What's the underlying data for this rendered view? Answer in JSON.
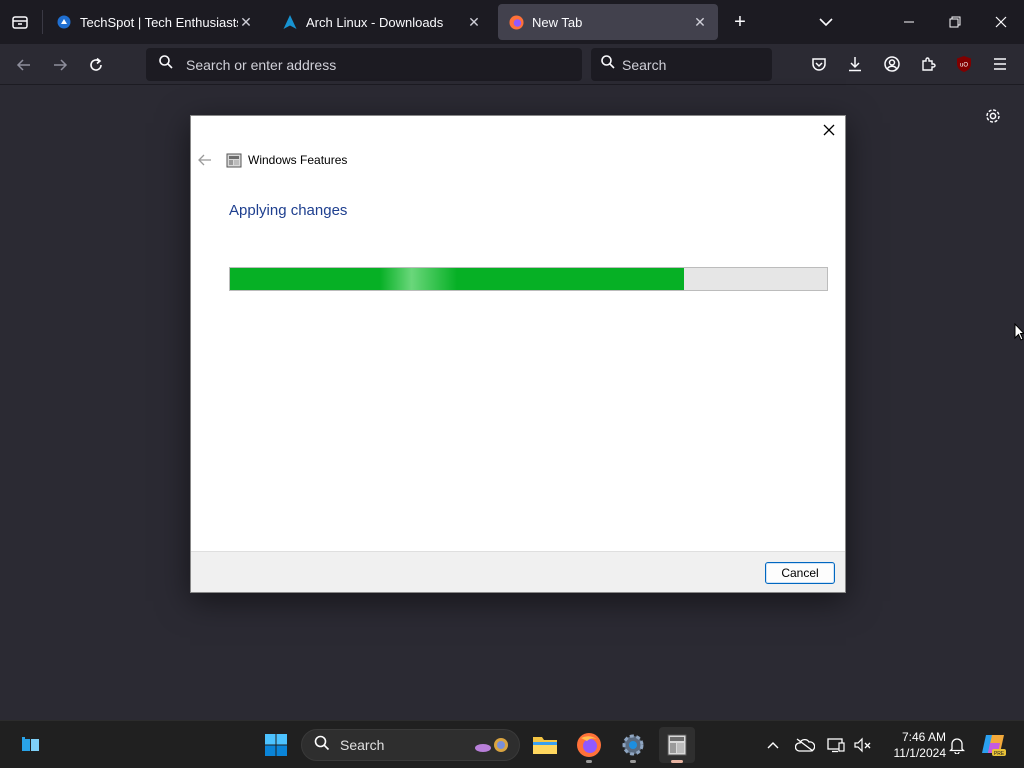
{
  "browser": {
    "tabs": [
      {
        "title": "TechSpot | Tech Enthusiasts, Po",
        "active": false,
        "favicon": "techspot-icon"
      },
      {
        "title": "Arch Linux - Downloads",
        "active": false,
        "favicon": "arch-linux-icon"
      },
      {
        "title": "New Tab",
        "active": true,
        "favicon": "firefox-icon"
      }
    ],
    "address_placeholder": "Search or enter address",
    "search_placeholder": "Search"
  },
  "dialog": {
    "app_title": "Windows Features",
    "heading": "Applying changes",
    "progress_fraction": 0.76,
    "cancel_label": "Cancel"
  },
  "taskbar": {
    "search_label": "Search",
    "time": "7:46 AM",
    "date": "11/1/2024"
  },
  "colors": {
    "progress_green": "#06b025",
    "heading_blue": "#1e3f8f",
    "browser_bg": "#2b2a33",
    "taskbar_bg": "#202020"
  }
}
